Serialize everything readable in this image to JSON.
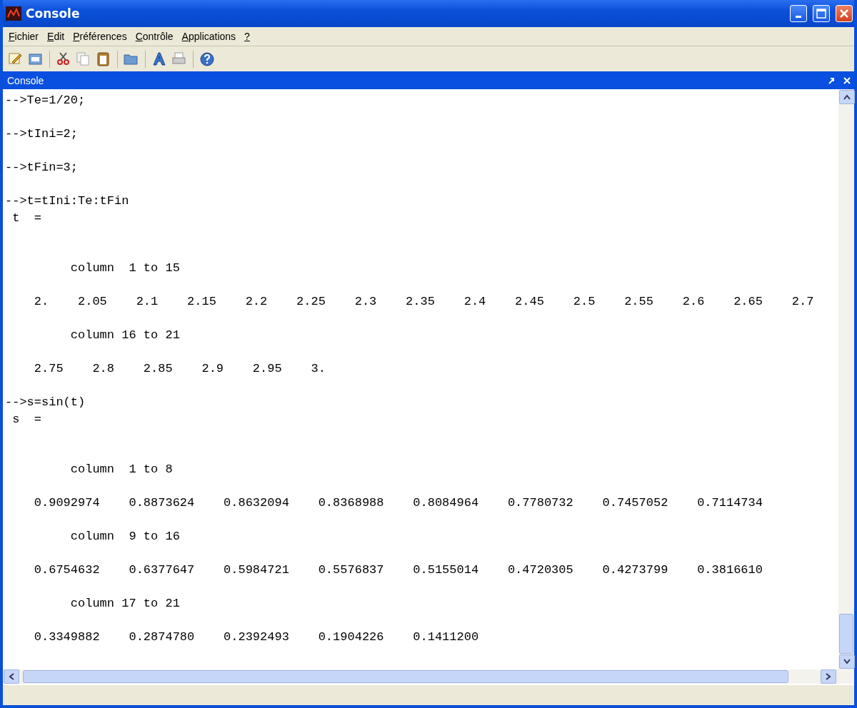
{
  "window": {
    "title": "Console"
  },
  "menu": [
    "Fichier",
    "Edit",
    "Préférences",
    "Contrôle",
    "Applications",
    "?"
  ],
  "panel": {
    "title": "Console"
  },
  "console_lines": [
    {
      "kind": "text",
      "text": "-->Te=1/20;"
    },
    {
      "kind": "blank"
    },
    {
      "kind": "text",
      "text": "-->tIni=2;"
    },
    {
      "kind": "blank"
    },
    {
      "kind": "text",
      "text": "-->tFin=3;"
    },
    {
      "kind": "blank"
    },
    {
      "kind": "text",
      "text": "-->t=tIni:Te:tFin"
    },
    {
      "kind": "text",
      "text": " t  ="
    },
    {
      "kind": "blank"
    },
    {
      "kind": "blank"
    },
    {
      "kind": "text",
      "text": "         column  1 to 15"
    },
    {
      "kind": "blank"
    },
    {
      "kind": "text",
      "text": "    2.    2.05    2.1    2.15    2.2    2.25    2.3    2.35    2.4    2.45    2.5    2.55    2.6    2.65    2.7"
    },
    {
      "kind": "blank"
    },
    {
      "kind": "text",
      "text": "         column 16 to 21"
    },
    {
      "kind": "blank"
    },
    {
      "kind": "text",
      "text": "    2.75    2.8    2.85    2.9    2.95    3."
    },
    {
      "kind": "blank"
    },
    {
      "kind": "text",
      "text": "-->s=sin(t)"
    },
    {
      "kind": "text",
      "text": " s  ="
    },
    {
      "kind": "blank"
    },
    {
      "kind": "blank"
    },
    {
      "kind": "text",
      "text": "         column  1 to 8"
    },
    {
      "kind": "blank"
    },
    {
      "kind": "text",
      "text": "    0.9092974    0.8873624    0.8632094    0.8368988    0.8084964    0.7780732    0.7457052    0.7114734"
    },
    {
      "kind": "blank"
    },
    {
      "kind": "text",
      "text": "         column  9 to 16"
    },
    {
      "kind": "blank"
    },
    {
      "kind": "text",
      "text": "    0.6754632    0.6377647    0.5984721    0.5576837    0.5155014    0.4720305    0.4273799    0.3816610"
    },
    {
      "kind": "blank"
    },
    {
      "kind": "text",
      "text": "         column 17 to 21"
    },
    {
      "kind": "blank"
    },
    {
      "kind": "text",
      "text": "    0.3349882    0.2874780    0.2392493    0.1904226    0.1411200"
    }
  ]
}
